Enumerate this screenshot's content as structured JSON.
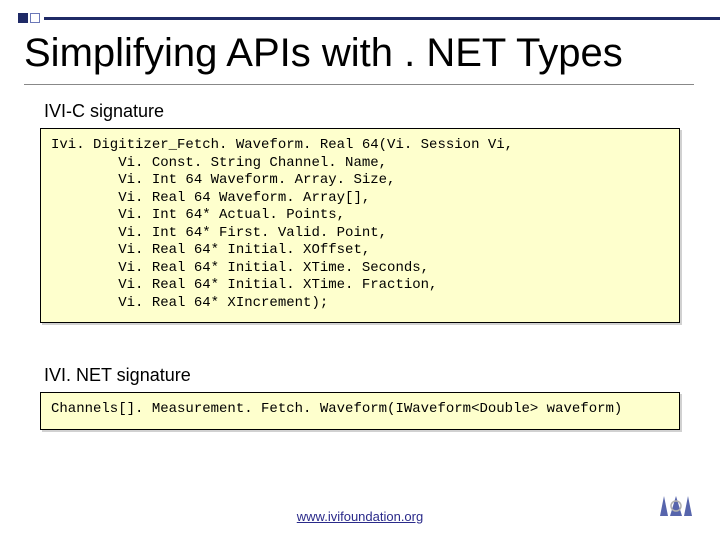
{
  "title": "Simplifying APIs with . NET Types",
  "section1": {
    "label": "IVI-C signature"
  },
  "code1": "Ivi. Digitizer_Fetch. Waveform. Real 64(Vi. Session Vi,\n        Vi. Const. String Channel. Name,\n        Vi. Int 64 Waveform. Array. Size,\n        Vi. Real 64 Waveform. Array[],\n        Vi. Int 64* Actual. Points,\n        Vi. Int 64* First. Valid. Point,\n        Vi. Real 64* Initial. XOffset,\n        Vi. Real 64* Initial. XTime. Seconds,\n        Vi. Real 64* Initial. XTime. Fraction,\n        Vi. Real 64* XIncrement);",
  "section2": {
    "label": "IVI. NET signature"
  },
  "code2": "Channels[]. Measurement. Fetch. Waveform(IWaveform<Double> waveform)",
  "footer": {
    "url": "www.ivifoundation.org"
  }
}
